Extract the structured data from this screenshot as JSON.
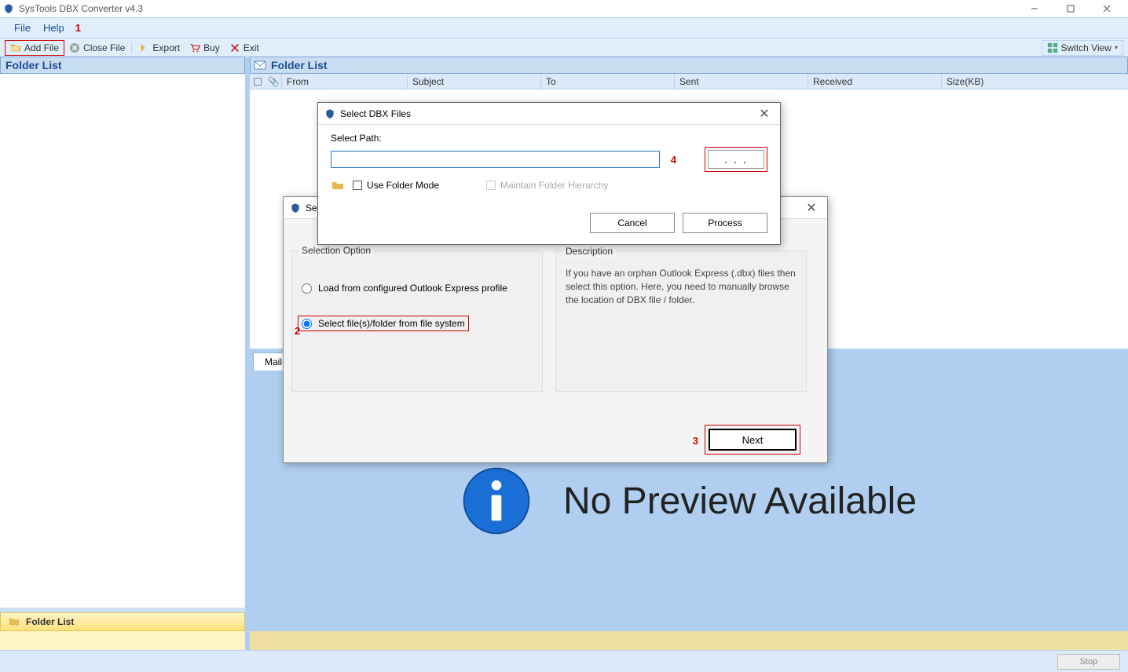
{
  "app": {
    "title": "SysTools DBX Converter v4.3"
  },
  "menu": {
    "file": "File",
    "help": "Help"
  },
  "toolbar": {
    "add_file": "Add File",
    "close_file": "Close File",
    "export": "Export",
    "buy": "Buy",
    "exit": "Exit",
    "switch_view": "Switch View"
  },
  "annotations": {
    "a1": "1",
    "a2": "2",
    "a3": "3",
    "a4": "4"
  },
  "left": {
    "header": "Folder List",
    "folder_btn": "Folder List"
  },
  "right": {
    "header": "Folder List",
    "columns": {
      "from": "From",
      "subject": "Subject",
      "to": "To",
      "sent": "Sent",
      "received": "Received",
      "size": "Size(KB)"
    },
    "mail_tab": "Mail",
    "no_preview": "No Preview Available"
  },
  "status": {
    "stop": "Stop"
  },
  "dialog_select_options": {
    "title": "Sele",
    "selection_legend": "Selection Option",
    "opt_profile": "Load from configured Outlook Express profile",
    "opt_filesystem": "Select file(s)/folder from file system",
    "desc_legend": "Description",
    "desc_text": "If you have an orphan Outlook Express (.dbx) files then select this option. Here, you need to manually browse the location of DBX file / folder.",
    "next": "Next"
  },
  "dialog_select_path": {
    "title": "Select DBX Files",
    "select_path": "Select Path:",
    "path_value": "",
    "browse": ". . .",
    "use_folder_mode": "Use Folder Mode",
    "maintain_hierarchy": "Maintain Folder Hierarchy",
    "cancel": "Cancel",
    "process": "Process"
  }
}
